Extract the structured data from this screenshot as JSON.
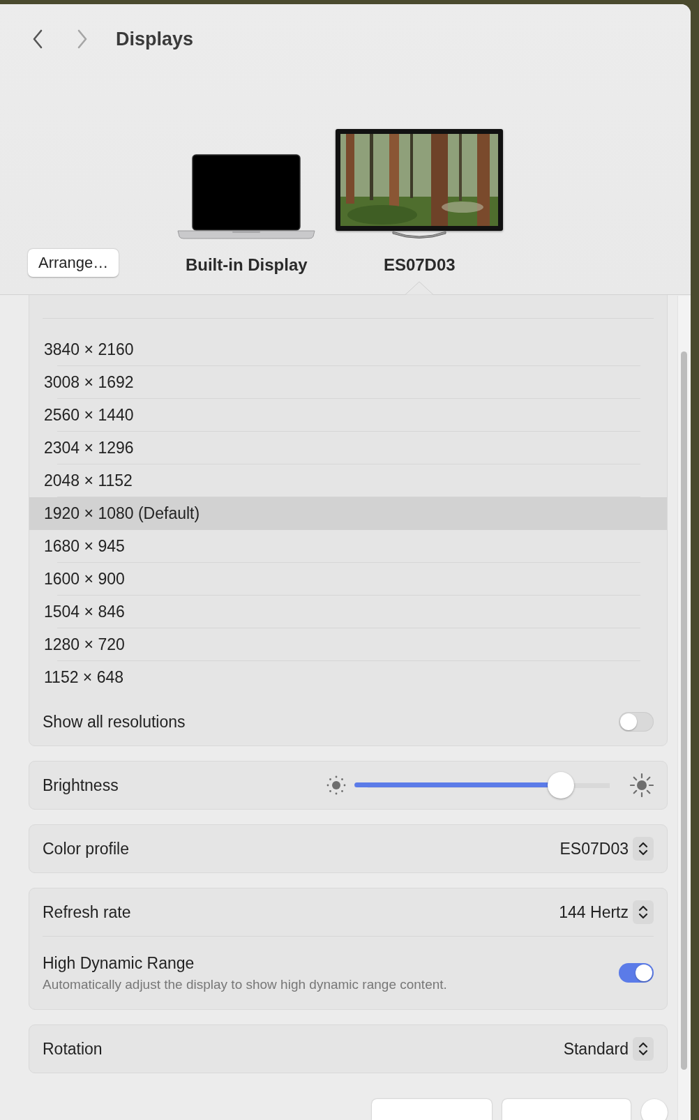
{
  "nav": {
    "title": "Displays"
  },
  "arrange_button": "Arrange…",
  "displays": [
    {
      "name": "Built-in Display",
      "kind": "laptop",
      "selected": false
    },
    {
      "name": "ES07D03",
      "kind": "monitor",
      "selected": true
    }
  ],
  "resolutions": [
    {
      "label": "3840 × 2160",
      "selected": false
    },
    {
      "label": "3008 × 1692",
      "selected": false
    },
    {
      "label": "2560 × 1440",
      "selected": false
    },
    {
      "label": "2304 × 1296",
      "selected": false
    },
    {
      "label": "2048 × 1152",
      "selected": false
    },
    {
      "label": "1920 × 1080 (Default)",
      "selected": true
    },
    {
      "label": "1680 × 945",
      "selected": false
    },
    {
      "label": "1600 × 900",
      "selected": false
    },
    {
      "label": "1504 × 846",
      "selected": false
    },
    {
      "label": "1280 × 720",
      "selected": false
    },
    {
      "label": "1152 × 648",
      "selected": false
    }
  ],
  "show_all": {
    "label": "Show all resolutions",
    "on": false
  },
  "brightness": {
    "label": "Brightness",
    "level": 0.77
  },
  "color_profile": {
    "label": "Color profile",
    "value": "ES07D03"
  },
  "refresh_rate": {
    "label": "Refresh rate",
    "value": "144 Hertz"
  },
  "hdr": {
    "label": "High Dynamic Range",
    "description": "Automatically adjust the display to show high dynamic range content.",
    "on": true
  },
  "rotation": {
    "label": "Rotation",
    "value": "Standard"
  }
}
